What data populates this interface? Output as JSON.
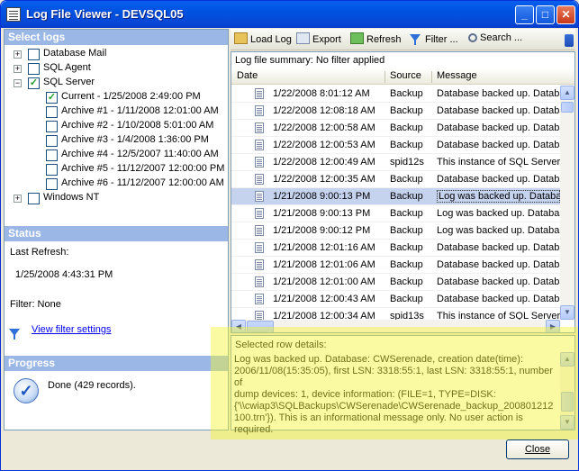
{
  "window": {
    "title": "Log File Viewer - DEVSQL05"
  },
  "left": {
    "select_logs_header": "Select logs",
    "tree": [
      {
        "label": "Database Mail",
        "checked": false,
        "expander": "+"
      },
      {
        "label": "SQL Agent",
        "checked": false,
        "expander": "+"
      },
      {
        "label": "SQL Server",
        "checked": true,
        "expander": "−"
      },
      {
        "label": "Current - 1/25/2008 2:49:00 PM",
        "checked": true
      },
      {
        "label": "Archive #1 - 1/11/2008 12:01:00 AM",
        "checked": false
      },
      {
        "label": "Archive #2 - 1/10/2008 5:01:00 AM",
        "checked": false
      },
      {
        "label": "Archive #3 - 1/4/2008 1:36:00 PM",
        "checked": false
      },
      {
        "label": "Archive #4 - 12/5/2007 11:40:00 AM",
        "checked": false
      },
      {
        "label": "Archive #5 - 11/12/2007 12:00:00 PM",
        "checked": false
      },
      {
        "label": "Archive #6 - 11/12/2007 12:00:00 AM",
        "checked": false
      },
      {
        "label": "Windows NT",
        "checked": false,
        "expander": "+"
      }
    ],
    "status_header": "Status",
    "last_refresh_label": "Last Refresh:",
    "last_refresh_value": "1/25/2008 4:43:31 PM",
    "filter_label": "Filter: None",
    "view_filter_link": "View filter settings",
    "progress_header": "Progress",
    "progress_text": "Done (429 records)."
  },
  "toolbar": {
    "load_log": "Load Log",
    "export": "Export",
    "refresh": "Refresh",
    "filter": "Filter ...",
    "search": "Search ..."
  },
  "grid": {
    "summary": "Log file summary: No filter applied",
    "columns": [
      "Date",
      "Source",
      "Message"
    ],
    "rows": [
      {
        "date": "1/22/2008 8:01:12 AM",
        "source": "Backup",
        "message": "Database backed up. Database"
      },
      {
        "date": "1/22/2008 12:08:18 AM",
        "source": "Backup",
        "message": "Database backed up. Database"
      },
      {
        "date": "1/22/2008 12:00:58 AM",
        "source": "Backup",
        "message": "Database backed up. Database"
      },
      {
        "date": "1/22/2008 12:00:53 AM",
        "source": "Backup",
        "message": "Database backed up. Database"
      },
      {
        "date": "1/22/2008 12:00:49 AM",
        "source": "spid12s",
        "message": "This instance of SQL Server"
      },
      {
        "date": "1/22/2008 12:00:35 AM",
        "source": "Backup",
        "message": "Database backed up. Database"
      },
      {
        "date": "1/21/2008 9:00:13 PM",
        "source": "Backup",
        "message": "Log was backed up. Database",
        "selected": true
      },
      {
        "date": "1/21/2008 9:00:13 PM",
        "source": "Backup",
        "message": "Log was backed up. Database"
      },
      {
        "date": "1/21/2008 9:00:12 PM",
        "source": "Backup",
        "message": "Log was backed up. Database"
      },
      {
        "date": "1/21/2008 12:01:16 AM",
        "source": "Backup",
        "message": "Database backed up. Database"
      },
      {
        "date": "1/21/2008 12:01:06 AM",
        "source": "Backup",
        "message": "Database backed up. Database"
      },
      {
        "date": "1/21/2008 12:01:00 AM",
        "source": "Backup",
        "message": "Database backed up. Database"
      },
      {
        "date": "1/21/2008 12:00:43 AM",
        "source": "Backup",
        "message": "Database backed up. Database"
      },
      {
        "date": "1/21/2008 12:00:34 AM",
        "source": "spid13s",
        "message": "This instance of SQL Server"
      }
    ]
  },
  "details": {
    "label": "Selected row details:",
    "lines": [
      "Log was backed up. Database: CWSerenade, creation date(time):",
      "2006/11/08(15:35:05), first LSN: 3318:55:1, last LSN: 3318:55:1, number of",
      "dump devices: 1, device information: (FILE=1, TYPE=DISK:",
      "{'\\\\cwiap3\\SQLBackups\\CWSerenade\\CWSerenade_backup_200801212",
      "100.trn'}). This is an informational message only. No user action is required."
    ]
  },
  "footer": {
    "close_label": "Close"
  },
  "colors": {
    "title_bar": "#0052e0",
    "section_header": "#9bb7e6",
    "selected_row": "#c6d3ef",
    "highlight": "#f5f532"
  }
}
